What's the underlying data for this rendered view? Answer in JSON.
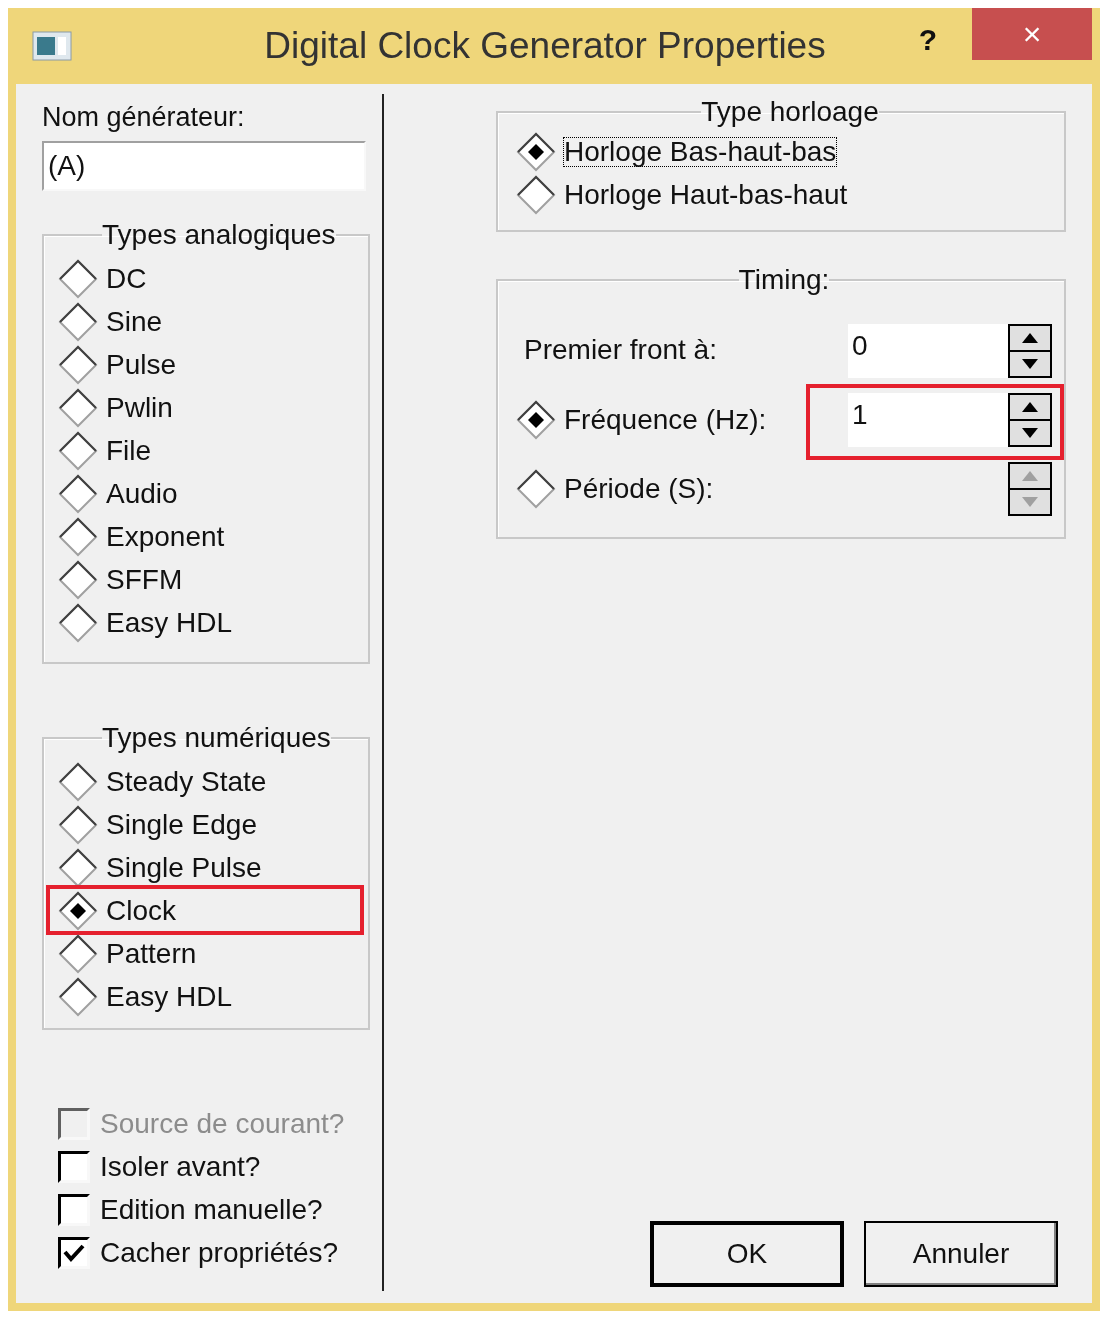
{
  "window": {
    "title": "Digital Clock Generator Properties",
    "help": "?",
    "close": "×"
  },
  "name_field": {
    "label": "Nom générateur:",
    "value": "(A)"
  },
  "analog_types": {
    "title": "Types analogiques",
    "items": [
      {
        "label": "DC",
        "selected": false
      },
      {
        "label": "Sine",
        "selected": false
      },
      {
        "label": "Pulse",
        "selected": false
      },
      {
        "label": "Pwlin",
        "selected": false
      },
      {
        "label": "File",
        "selected": false
      },
      {
        "label": "Audio",
        "selected": false
      },
      {
        "label": "Exponent",
        "selected": false
      },
      {
        "label": "SFFM",
        "selected": false
      },
      {
        "label": "Easy HDL",
        "selected": false
      }
    ]
  },
  "digital_types": {
    "title": "Types numériques",
    "items": [
      {
        "label": "Steady State",
        "selected": false,
        "highlighted": false
      },
      {
        "label": "Single Edge",
        "selected": false,
        "highlighted": false
      },
      {
        "label": "Single Pulse",
        "selected": false,
        "highlighted": false
      },
      {
        "label": "Clock",
        "selected": true,
        "highlighted": true
      },
      {
        "label": "Pattern",
        "selected": false,
        "highlighted": false
      },
      {
        "label": "Easy HDL",
        "selected": false,
        "highlighted": false
      }
    ]
  },
  "checkboxes": [
    {
      "label": "Source de courant?",
      "checked": false,
      "disabled": true
    },
    {
      "label": "Isoler avant?",
      "checked": false,
      "disabled": false
    },
    {
      "label": "Edition manuelle?",
      "checked": false,
      "disabled": false
    },
    {
      "label": "Cacher propriétés?",
      "checked": true,
      "disabled": false
    }
  ],
  "clock_type": {
    "title": "Type horloage",
    "items": [
      {
        "label": "Horloge Bas-haut-bas",
        "selected": true,
        "focused": true
      },
      {
        "label": "Horloge Haut-bas-haut",
        "selected": false,
        "focused": false
      }
    ]
  },
  "timing": {
    "title": "Timing:",
    "rows": [
      {
        "kind": "label",
        "label": "Premier front à:",
        "value": "0",
        "disabled": false,
        "highlighted": false
      },
      {
        "kind": "radio",
        "label": "Fréquence (Hz):",
        "selected": true,
        "value": "1",
        "disabled": false,
        "highlighted": true
      },
      {
        "kind": "radio",
        "label": "Période (S):",
        "selected": false,
        "disabled": true,
        "highlighted": false
      }
    ]
  },
  "buttons": [
    {
      "label": "OK",
      "default": true
    },
    {
      "label": "Annuler",
      "default": false
    }
  ]
}
